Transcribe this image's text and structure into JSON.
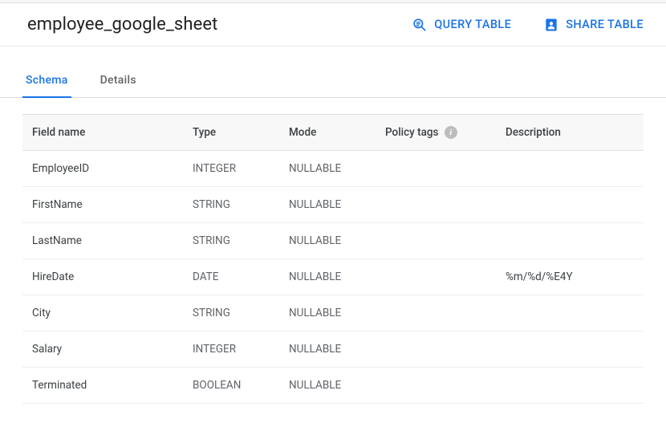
{
  "header": {
    "title": "employee_google_sheet",
    "query_label": "QUERY TABLE",
    "share_label": "SHARE TABLE"
  },
  "tabs": {
    "schema": "Schema",
    "details": "Details"
  },
  "schema_table": {
    "columns": {
      "field": "Field name",
      "type": "Type",
      "mode": "Mode",
      "policy": "Policy tags",
      "description": "Description"
    },
    "rows": [
      {
        "field": "EmployeeID",
        "type": "INTEGER",
        "mode": "NULLABLE",
        "policy": "",
        "description": ""
      },
      {
        "field": "FirstName",
        "type": "STRING",
        "mode": "NULLABLE",
        "policy": "",
        "description": ""
      },
      {
        "field": "LastName",
        "type": "STRING",
        "mode": "NULLABLE",
        "policy": "",
        "description": ""
      },
      {
        "field": "HireDate",
        "type": "DATE",
        "mode": "NULLABLE",
        "policy": "",
        "description": "%m/%d/%E4Y"
      },
      {
        "field": "City",
        "type": "STRING",
        "mode": "NULLABLE",
        "policy": "",
        "description": ""
      },
      {
        "field": "Salary",
        "type": "INTEGER",
        "mode": "NULLABLE",
        "policy": "",
        "description": ""
      },
      {
        "field": "Terminated",
        "type": "BOOLEAN",
        "mode": "NULLABLE",
        "policy": "",
        "description": ""
      }
    ]
  }
}
